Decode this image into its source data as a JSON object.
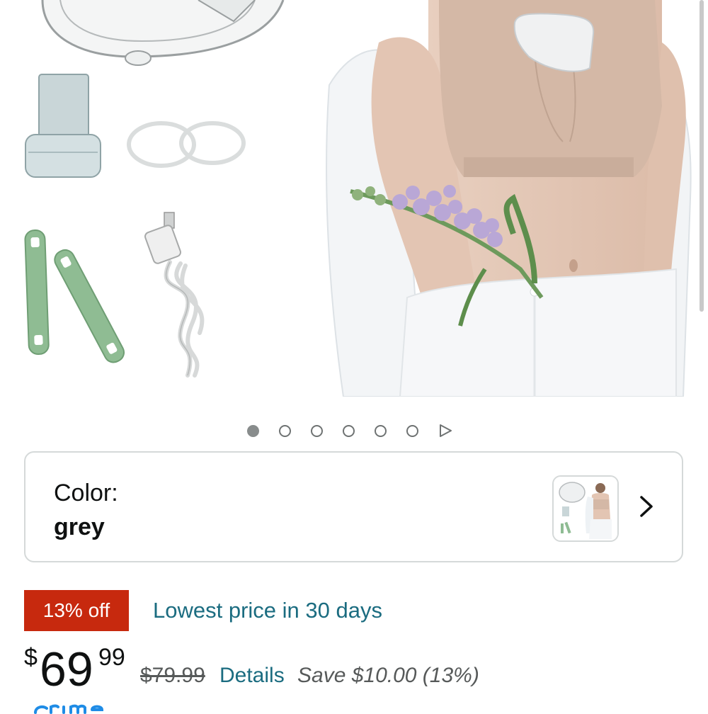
{
  "carousel": {
    "dot_count": 6,
    "active_index": 0
  },
  "color_selector": {
    "label": "Color:",
    "value": "grey"
  },
  "pricing": {
    "deal_badge": "13% off",
    "deal_note": "Lowest price in 30 days",
    "currency_symbol": "$",
    "price_whole": "69",
    "price_fraction": "99",
    "list_price": "$79.99",
    "details_link": "Details",
    "savings": "Save $10.00 (13%)"
  },
  "colors": {
    "deal_red": "#c7290e",
    "link_teal": "#1b6c80",
    "prime_blue": "#1f8ce6"
  },
  "icons": {
    "carousel_play": "play-triangle-icon",
    "color_chevron": "chevron-right-icon"
  }
}
